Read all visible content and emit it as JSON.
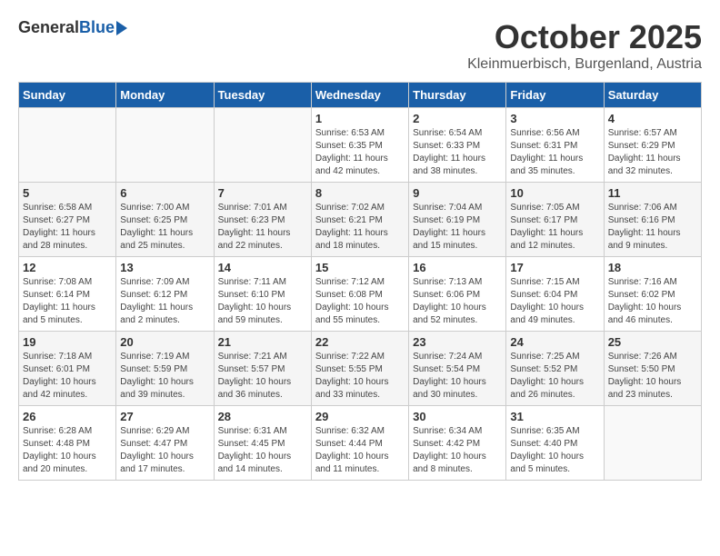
{
  "header": {
    "logo_general": "General",
    "logo_blue": "Blue",
    "month": "October 2025",
    "location": "Kleinmuerbisch, Burgenland, Austria"
  },
  "weekdays": [
    "Sunday",
    "Monday",
    "Tuesday",
    "Wednesday",
    "Thursday",
    "Friday",
    "Saturday"
  ],
  "weeks": [
    [
      {
        "day": "",
        "info": ""
      },
      {
        "day": "",
        "info": ""
      },
      {
        "day": "",
        "info": ""
      },
      {
        "day": "1",
        "info": "Sunrise: 6:53 AM\nSunset: 6:35 PM\nDaylight: 11 hours\nand 42 minutes."
      },
      {
        "day": "2",
        "info": "Sunrise: 6:54 AM\nSunset: 6:33 PM\nDaylight: 11 hours\nand 38 minutes."
      },
      {
        "day": "3",
        "info": "Sunrise: 6:56 AM\nSunset: 6:31 PM\nDaylight: 11 hours\nand 35 minutes."
      },
      {
        "day": "4",
        "info": "Sunrise: 6:57 AM\nSunset: 6:29 PM\nDaylight: 11 hours\nand 32 minutes."
      }
    ],
    [
      {
        "day": "5",
        "info": "Sunrise: 6:58 AM\nSunset: 6:27 PM\nDaylight: 11 hours\nand 28 minutes."
      },
      {
        "day": "6",
        "info": "Sunrise: 7:00 AM\nSunset: 6:25 PM\nDaylight: 11 hours\nand 25 minutes."
      },
      {
        "day": "7",
        "info": "Sunrise: 7:01 AM\nSunset: 6:23 PM\nDaylight: 11 hours\nand 22 minutes."
      },
      {
        "day": "8",
        "info": "Sunrise: 7:02 AM\nSunset: 6:21 PM\nDaylight: 11 hours\nand 18 minutes."
      },
      {
        "day": "9",
        "info": "Sunrise: 7:04 AM\nSunset: 6:19 PM\nDaylight: 11 hours\nand 15 minutes."
      },
      {
        "day": "10",
        "info": "Sunrise: 7:05 AM\nSunset: 6:17 PM\nDaylight: 11 hours\nand 12 minutes."
      },
      {
        "day": "11",
        "info": "Sunrise: 7:06 AM\nSunset: 6:16 PM\nDaylight: 11 hours\nand 9 minutes."
      }
    ],
    [
      {
        "day": "12",
        "info": "Sunrise: 7:08 AM\nSunset: 6:14 PM\nDaylight: 11 hours\nand 5 minutes."
      },
      {
        "day": "13",
        "info": "Sunrise: 7:09 AM\nSunset: 6:12 PM\nDaylight: 11 hours\nand 2 minutes."
      },
      {
        "day": "14",
        "info": "Sunrise: 7:11 AM\nSunset: 6:10 PM\nDaylight: 10 hours\nand 59 minutes."
      },
      {
        "day": "15",
        "info": "Sunrise: 7:12 AM\nSunset: 6:08 PM\nDaylight: 10 hours\nand 55 minutes."
      },
      {
        "day": "16",
        "info": "Sunrise: 7:13 AM\nSunset: 6:06 PM\nDaylight: 10 hours\nand 52 minutes."
      },
      {
        "day": "17",
        "info": "Sunrise: 7:15 AM\nSunset: 6:04 PM\nDaylight: 10 hours\nand 49 minutes."
      },
      {
        "day": "18",
        "info": "Sunrise: 7:16 AM\nSunset: 6:02 PM\nDaylight: 10 hours\nand 46 minutes."
      }
    ],
    [
      {
        "day": "19",
        "info": "Sunrise: 7:18 AM\nSunset: 6:01 PM\nDaylight: 10 hours\nand 42 minutes."
      },
      {
        "day": "20",
        "info": "Sunrise: 7:19 AM\nSunset: 5:59 PM\nDaylight: 10 hours\nand 39 minutes."
      },
      {
        "day": "21",
        "info": "Sunrise: 7:21 AM\nSunset: 5:57 PM\nDaylight: 10 hours\nand 36 minutes."
      },
      {
        "day": "22",
        "info": "Sunrise: 7:22 AM\nSunset: 5:55 PM\nDaylight: 10 hours\nand 33 minutes."
      },
      {
        "day": "23",
        "info": "Sunrise: 7:24 AM\nSunset: 5:54 PM\nDaylight: 10 hours\nand 30 minutes."
      },
      {
        "day": "24",
        "info": "Sunrise: 7:25 AM\nSunset: 5:52 PM\nDaylight: 10 hours\nand 26 minutes."
      },
      {
        "day": "25",
        "info": "Sunrise: 7:26 AM\nSunset: 5:50 PM\nDaylight: 10 hours\nand 23 minutes."
      }
    ],
    [
      {
        "day": "26",
        "info": "Sunrise: 6:28 AM\nSunset: 4:48 PM\nDaylight: 10 hours\nand 20 minutes."
      },
      {
        "day": "27",
        "info": "Sunrise: 6:29 AM\nSunset: 4:47 PM\nDaylight: 10 hours\nand 17 minutes."
      },
      {
        "day": "28",
        "info": "Sunrise: 6:31 AM\nSunset: 4:45 PM\nDaylight: 10 hours\nand 14 minutes."
      },
      {
        "day": "29",
        "info": "Sunrise: 6:32 AM\nSunset: 4:44 PM\nDaylight: 10 hours\nand 11 minutes."
      },
      {
        "day": "30",
        "info": "Sunrise: 6:34 AM\nSunset: 4:42 PM\nDaylight: 10 hours\nand 8 minutes."
      },
      {
        "day": "31",
        "info": "Sunrise: 6:35 AM\nSunset: 4:40 PM\nDaylight: 10 hours\nand 5 minutes."
      },
      {
        "day": "",
        "info": ""
      }
    ]
  ]
}
